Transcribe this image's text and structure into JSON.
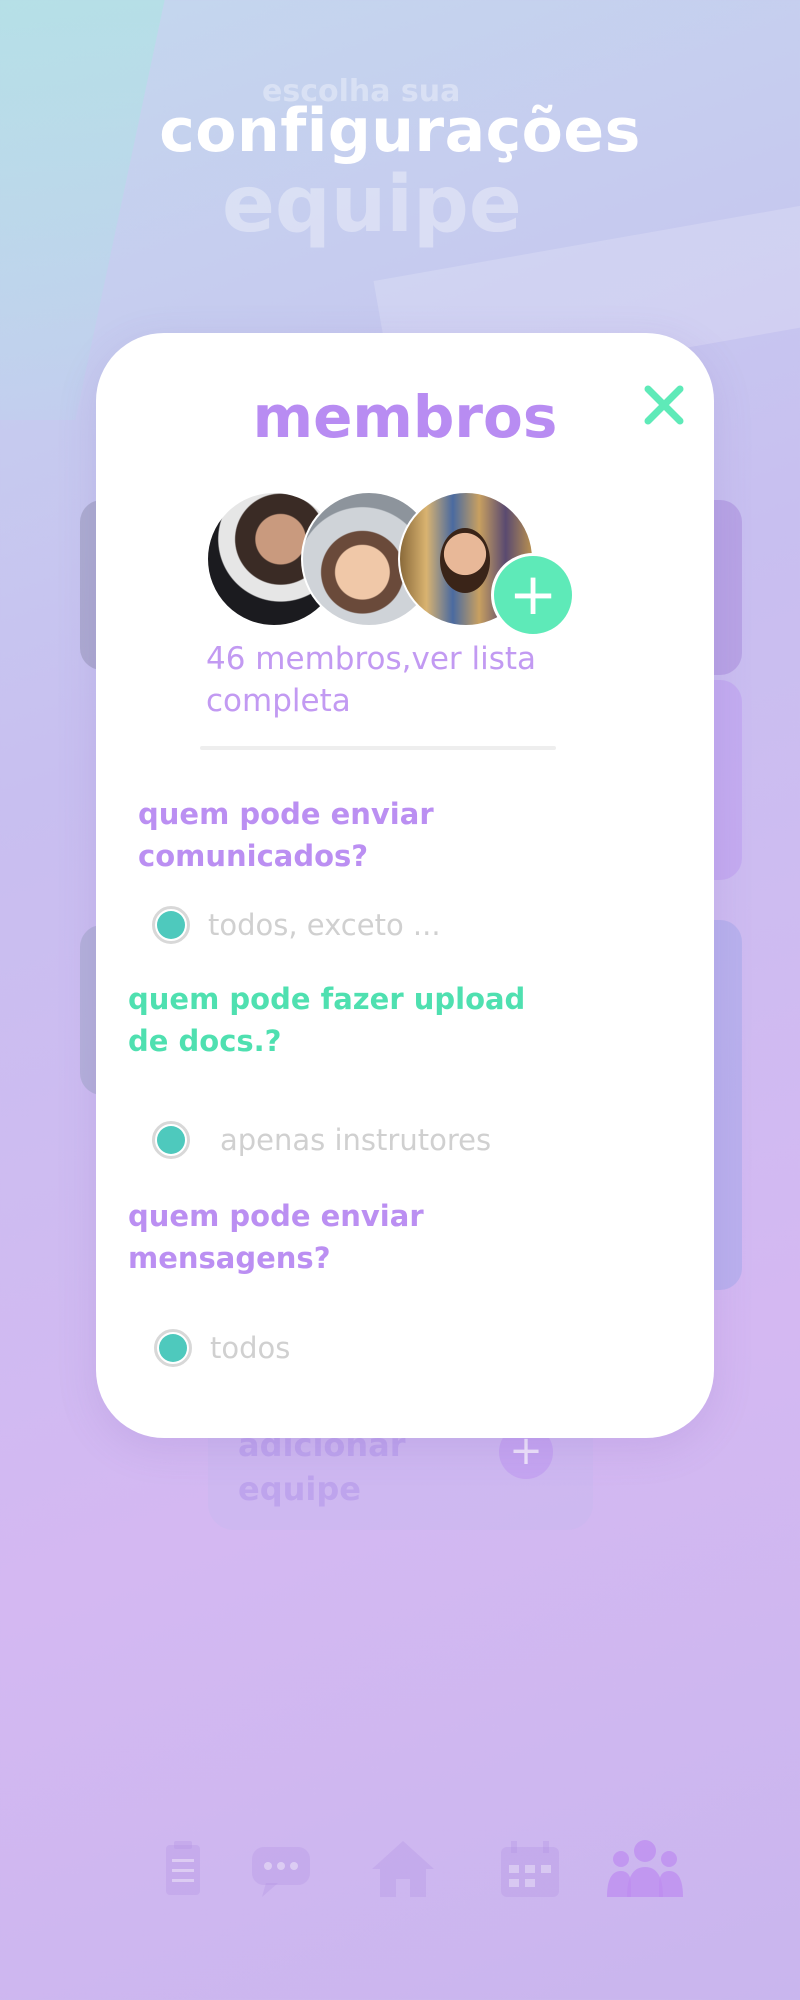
{
  "background": {
    "ghost_subtitle": "escolha sua",
    "ghost_title": "equipe",
    "page_title": "configurações",
    "add_team_label": "adicionar equipe",
    "add_team_plus": "+"
  },
  "tabbar": {
    "tabs": [
      {
        "icon": "checklist-icon",
        "active": false
      },
      {
        "icon": "chat-icon",
        "active": false
      },
      {
        "icon": "home-icon",
        "active": false
      },
      {
        "icon": "calendar-icon",
        "active": false
      },
      {
        "icon": "team-icon",
        "active": true
      }
    ]
  },
  "modal": {
    "title": "membros",
    "close_icon": "close-icon",
    "add_member_plus": "+",
    "members_text": "46 membros,ver lista completa",
    "questions": [
      {
        "text": "quem pode enviar comunicados?",
        "color": "#bb8ff2",
        "option": "todos, exceto ..."
      },
      {
        "text": "quem pode fazer upload de docs.?",
        "color": "#4fe0b0",
        "option": "apenas instrutores"
      },
      {
        "text": "quem pode enviar mensagens?",
        "color": "#bb8ff2",
        "option": "todos"
      }
    ]
  },
  "colors": {
    "accent_purple": "#b88cf2",
    "accent_green": "#5eeab8",
    "radio_teal": "#4ec9bd"
  }
}
